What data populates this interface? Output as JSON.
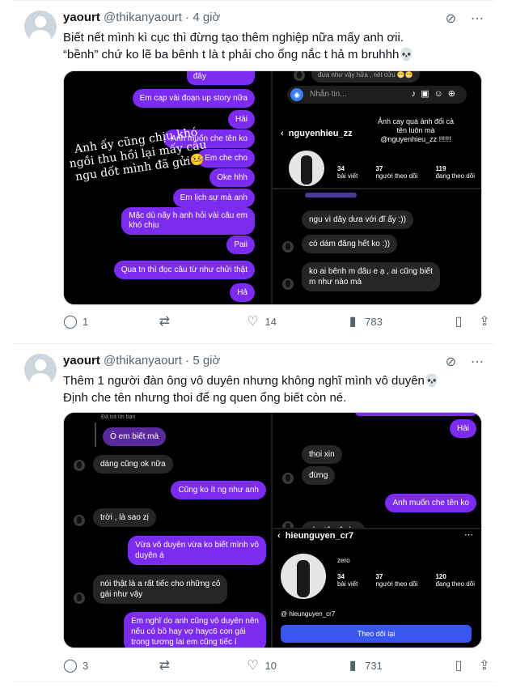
{
  "tweets": [
    {
      "name": "yaourt",
      "handle": "@thikanyaourt",
      "dot": "·",
      "time": "4 giờ",
      "text1": "Biết nết mình kì cục thì đừng tạo thêm nghiệp nữa mấy anh ơii.",
      "text2": "“bềnh” chứ ko lẽ ba bênh t là t phải cho ổng nắc t hả m bruhhh💀",
      "replies": "1",
      "retweets": "",
      "likes": "14",
      "views": "783",
      "media": {
        "left": {
          "bubbles": [
            "đây",
            "Em cap vài đoạn up story nữa",
            "Hài",
            "Anh muốn che tên ko",
            "Em che cho",
            "Oke hhh",
            "Em lịch sự mà anh",
            "Mặc dù nãy h anh hỏi vài câu em\nkhó chịu",
            "Paii",
            "Qua tn thì đọc câu từ như chửi thật",
            "Hả"
          ],
          "overlay": "Anh ấy cũng chịu khó\nngồi thu hồi lại mấy câu\nngu dốt mình đã gửi🤒"
        },
        "right_top": {
          "top_text": "đưa như vậy hửa , nét cửu 😁😁",
          "input_placeholder": "Nhắn tin...",
          "username": "nguyenhieu_zz",
          "caption": "Ảnh cay quá ảnh đổi cả\ntên luôn mà\n@nguyenhieu_zz !!!!!!",
          "stats": [
            {
              "n": "34",
              "l": "bài viết"
            },
            {
              "n": "37",
              "l": "người theo dõi"
            },
            {
              "n": "119",
              "l": "đang theo dõi"
            }
          ]
        },
        "right_bottom": {
          "bubbles": [
            "ngu vì dây dưa với đĩ ấy :))",
            "có dám đăng hết ko :))",
            "ko ai bênh m đâu e ạ , ai cũng biết\nm như nào mà"
          ]
        }
      }
    },
    {
      "name": "yaourt",
      "handle": "@thikanyaourt",
      "dot": "·",
      "time": "5 giờ",
      "text1": "Thêm 1 người đàn ông vô duyên nhưng không nghĩ mình vô duyên💀",
      "text2": "Định che tên nhưng thoi để ng quen ổng biết còn né.",
      "replies": "3",
      "retweets": "",
      "likes": "10",
      "views": "731",
      "media": {
        "left": {
          "reply_note": "Đã trả lời bạn",
          "bubbles": [
            "Ò em biết mà",
            "dáng cũng ok nữa",
            "Cũng ko ít ng như anh",
            "trời , là sao zị",
            "Vừa vô duyên vừa ko biết mình vô\nduyên á",
            "nói thật là a rất tiếc cho những cô\ngái như vậy",
            "Em nghĩ do anh cũng vô duyên nên\nnếu có bồ hay vợ hayc6 con gái\ntrong tương lai em cũng tiếc í"
          ]
        },
        "right_top": {
          "bubbles": [
            "Hài",
            "thoi xin",
            "đừng",
            "Anh muốn che tên ko",
            "che tên đe ko"
          ]
        },
        "right_bottom": {
          "username": "hieunguyen_cr7",
          "bio": "zero",
          "stats": [
            {
              "n": "34",
              "l": "bài viết"
            },
            {
              "n": "37",
              "l": "người theo dõi"
            },
            {
              "n": "120",
              "l": "đang theo dõi"
            }
          ],
          "threads": "hieunguyen_cr7",
          "follow_back": "Theo dõi lại"
        }
      }
    }
  ],
  "icons": {
    "grok": "grok-icon",
    "more": "more-icon",
    "reply": "reply-icon",
    "retweet": "retweet-icon",
    "like": "like-icon",
    "views": "views-icon",
    "bookmark": "bookmark-icon",
    "share": "share-icon"
  }
}
